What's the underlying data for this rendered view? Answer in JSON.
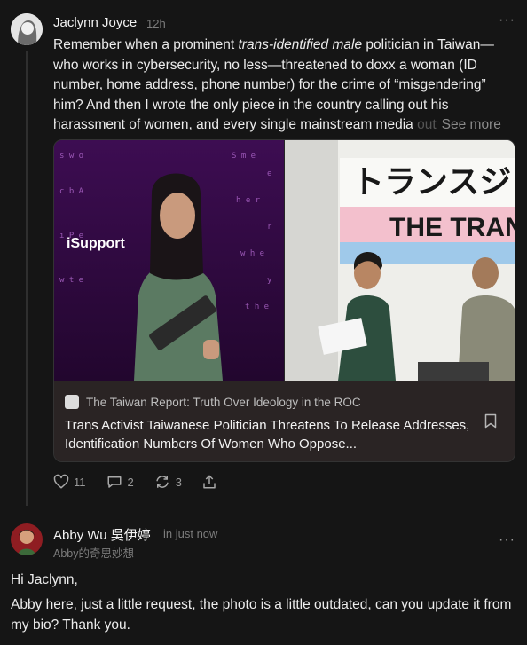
{
  "post": {
    "author": "Jaclynn Joyce",
    "time": "12h",
    "text_parts": {
      "p1": "Remember when a prominent ",
      "italic": "trans-identified male",
      "p2": " politician in Taiwan—who works in cybersecurity, no less—threatened to doxx a woman (ID number, home address, phone number) for the crime of “misgendering” him? And then I wrote the only piece in the country calling out his harassment of women, and every single mainstream media ",
      "faded": "out",
      "see_more": "See more"
    },
    "card": {
      "image_left_caption": "iSupport",
      "image_right_sign_jp": "トランスジェ",
      "image_right_sign_en": "THE TRANS",
      "publication": "The Taiwan Report: Truth Over Ideology in the ROC",
      "title": "Trans Activist Taiwanese Politician Threatens To Release Addresses, Identification Numbers Of Women Who Oppose..."
    },
    "actions": {
      "likes": "11",
      "comments": "2",
      "restacks": "3"
    }
  },
  "reply": {
    "author": "Abby Wu 吳伊婷",
    "time": "in just now",
    "subtitle": "Abby的奇思妙想",
    "greeting": "Hi Jaclynn,",
    "message": "Abby here, just a little request, the photo is a little outdated, can you update it from my bio? Thank you."
  },
  "icons": [
    "more-dots-icon",
    "heart-icon",
    "comment-icon",
    "restack-icon",
    "share-icon",
    "bookmark-icon"
  ]
}
